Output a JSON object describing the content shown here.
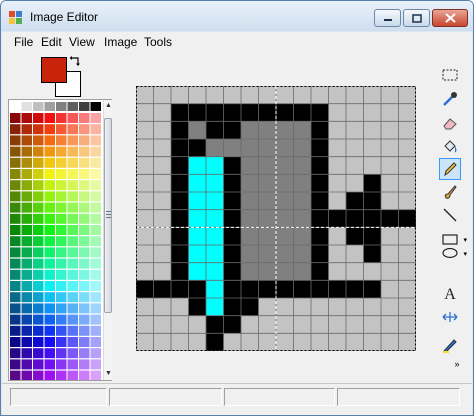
{
  "window": {
    "title": "Image Editor",
    "controls": [
      "minimize",
      "maximize",
      "close"
    ]
  },
  "menu": {
    "items": [
      "File",
      "Edit",
      "View",
      "Image",
      "Tools"
    ]
  },
  "colors": {
    "foreground": "#c8240b",
    "background": "#ffffff",
    "swap_icon": "swap-arrows-icon"
  },
  "toolbar": {
    "tools": [
      {
        "name": "rectangle-select-icon"
      },
      {
        "name": "color-picker-icon"
      },
      {
        "name": "eraser-icon"
      },
      {
        "name": "fill-bucket-icon"
      },
      {
        "name": "pencil-icon",
        "selected": true
      },
      {
        "name": "brush-icon"
      },
      {
        "name": "line-icon"
      },
      {
        "name": "rectangle-icon"
      },
      {
        "name": "ellipse-icon"
      },
      {
        "name": "text-icon"
      },
      {
        "name": "move-icon"
      },
      {
        "name": "highlighter-icon"
      }
    ]
  },
  "canvas": {
    "columns": 16,
    "rows": 15,
    "grid_color": "#6a6a6a",
    "pixels": [
      "................",
      "..kkkkkkkkk.....",
      "..kGkkGGGGk.....",
      "..kkGGGGGGk.....",
      "..kCCkGGGGk.....",
      "..kCCkGGGGk..k..",
      "..kCCkGGGGk.kk..",
      "..kCCkGGGGkkkkkk",
      "..kCCkGGGGk.kk..",
      "..kCCkGGGGk..k..",
      "..kCCkGGGGk.....",
      "kkkkCkkkkkkkkk..",
      "...kCkk.........",
      "....kk..........",
      "....k..........."
    ],
    "palette": {
      ".": "#c3c3c3",
      "k": "#000000",
      "G": "#808080",
      "C": "#00ffff"
    }
  },
  "status": {
    "panels": [
      "",
      "",
      "",
      ""
    ]
  }
}
